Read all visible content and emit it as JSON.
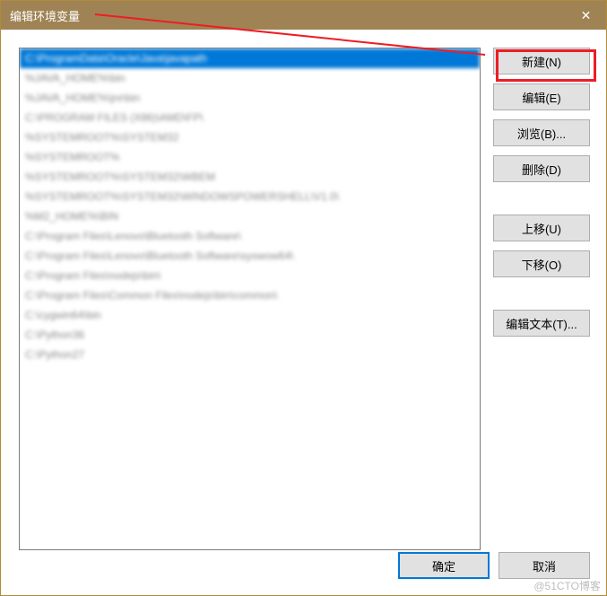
{
  "window": {
    "title": "编辑环境变量",
    "close_glyph": "✕"
  },
  "list": {
    "items": [
      "C:\\ProgramData\\Oracle\\Java\\javapath",
      "%JAVA_HOME%\\bin",
      "%JAVA_HOME%\\jre\\bin",
      "C:\\PROGRAM FILES (X86)\\AMD\\FP\\",
      "%SYSTEMROOT%\\SYSTEM32",
      "%SYSTEMROOT%",
      "%SYSTEMROOT%\\SYSTEM32\\WBEM",
      "%SYSTEMROOT%\\SYSTEM32\\WINDOWSPOWERSHELL\\V1.0\\",
      "%M2_HOME%\\BIN",
      "C:\\Program Files\\Lenovo\\Bluetooth Software\\",
      "C:\\Program Files\\Lenovo\\Bluetooth Software\\syswow64\\",
      "C:\\Program Files\\nodejs\\bin\\",
      "C:\\Program Files\\Common Files\\nodejs\\bin\\common\\",
      "C:\\cygwin64\\bin",
      "C:\\Python36",
      "C:\\Python27"
    ],
    "selected_index": 0
  },
  "buttons": {
    "new": "新建(N)",
    "edit": "编辑(E)",
    "browse": "浏览(B)...",
    "delete": "删除(D)",
    "move_up": "上移(U)",
    "move_down": "下移(O)",
    "edit_text": "编辑文本(T)...",
    "ok": "确定",
    "cancel": "取消"
  },
  "watermark": "@51CTO博客"
}
